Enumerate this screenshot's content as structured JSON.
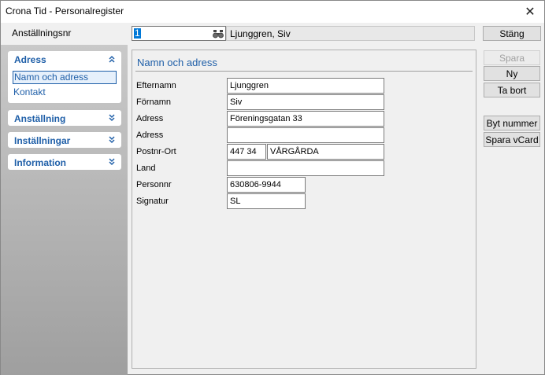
{
  "window": {
    "title": "Crona Tid - Personalregister"
  },
  "toprow": {
    "label": "Anställningsnr",
    "employee_number": "1",
    "employee_name": "Ljunggren, Siv"
  },
  "buttons": {
    "close": "Stäng",
    "save": "Spara",
    "new": "Ny",
    "delete": "Ta bort",
    "change_number": "Byt nummer",
    "save_vcard": "Spara vCard"
  },
  "sidebar": {
    "groups": [
      {
        "title": "Adress",
        "expanded": true,
        "items": [
          "Namn och adress",
          "Kontakt"
        ],
        "selected": "Namn och adress"
      },
      {
        "title": "Anställning",
        "expanded": false
      },
      {
        "title": "Inställningar",
        "expanded": false
      },
      {
        "title": "Information",
        "expanded": false
      }
    ]
  },
  "main": {
    "section_title": "Namn och adress",
    "fields": {
      "efternamn": {
        "label": "Efternamn",
        "value": "Ljunggren"
      },
      "fornamn": {
        "label": "Förnamn",
        "value": "Siv"
      },
      "adress1": {
        "label": "Adress",
        "value": "Föreningsgatan 33"
      },
      "adress2": {
        "label": "Adress",
        "value": ""
      },
      "postnr": {
        "label": "Postnr-Ort",
        "value": "447 34"
      },
      "ort": {
        "value": "VÅRGÅRDA"
      },
      "land": {
        "label": "Land",
        "value": ""
      },
      "personnr": {
        "label": "Personnr",
        "value": "630806-9944"
      },
      "signatur": {
        "label": "Signatur",
        "value": "SL"
      }
    }
  },
  "colors": {
    "accent": "#1f5fa8",
    "selection": "#0078d7"
  },
  "icons": {
    "search": "binoculars-icon",
    "collapse": "double-chevron-up-icon",
    "expand": "double-chevron-down-icon",
    "close": "close-icon"
  }
}
